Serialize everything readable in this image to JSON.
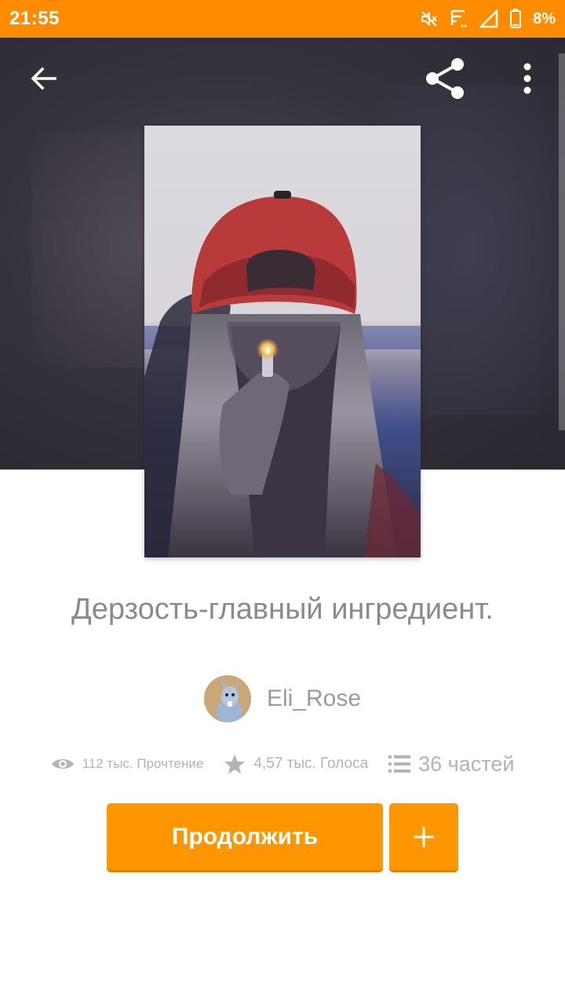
{
  "status_bar": {
    "time": "21:55",
    "battery": "8%",
    "icons": [
      "mute-icon",
      "signal-indicator-icon",
      "cell-signal-icon",
      "battery-icon"
    ],
    "color": "#ff8c00"
  },
  "toolbar": {
    "back_icon": "arrow-back-icon",
    "share_icon": "share-icon",
    "more_icon": "more-vert-icon"
  },
  "story": {
    "title": "Дерзость-главный ингредиент.",
    "author": "Eli_Rose",
    "stats": {
      "reads": "112 тыс. Прочтение",
      "votes": "4,57 тыс. Голоса",
      "parts": "36 частей"
    }
  },
  "actions": {
    "continue_label": "Продолжить",
    "add_icon": "plus-icon",
    "accent": "#ff9600"
  }
}
